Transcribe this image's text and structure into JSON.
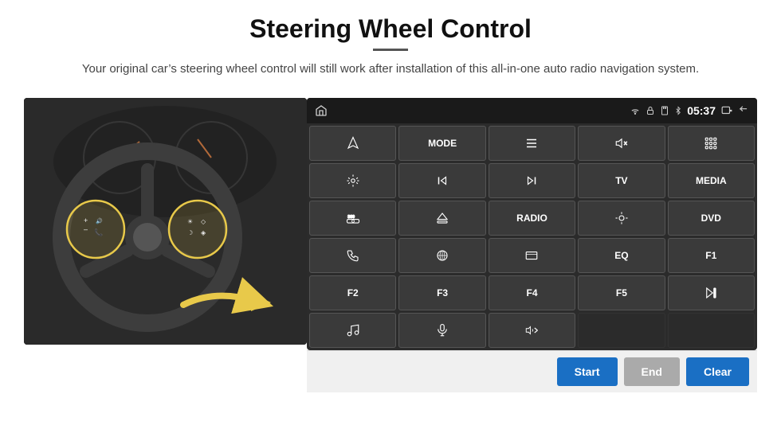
{
  "header": {
    "title": "Steering Wheel Control",
    "subtitle": "Your original car’s steering wheel control will still work after installation of this all-in-one auto radio navigation system."
  },
  "topbar": {
    "time": "05:37"
  },
  "panel_buttons": [
    {
      "id": "row1",
      "cells": [
        {
          "label": "",
          "icon": "home"
        },
        {
          "label": "MODE",
          "icon": ""
        },
        {
          "label": "",
          "icon": "list"
        },
        {
          "label": "",
          "icon": "vol-mute"
        },
        {
          "label": "",
          "icon": "apps"
        }
      ]
    },
    {
      "id": "row2",
      "cells": [
        {
          "label": "",
          "icon": "settings"
        },
        {
          "label": "",
          "icon": "prev"
        },
        {
          "label": "",
          "icon": "next"
        },
        {
          "label": "TV",
          "icon": ""
        },
        {
          "label": "MEDIA",
          "icon": ""
        }
      ]
    },
    {
      "id": "row3",
      "cells": [
        {
          "label": "",
          "icon": "360cam"
        },
        {
          "label": "",
          "icon": "eject"
        },
        {
          "label": "RADIO",
          "icon": ""
        },
        {
          "label": "",
          "icon": "brightness"
        },
        {
          "label": "DVD",
          "icon": ""
        }
      ]
    },
    {
      "id": "row4",
      "cells": [
        {
          "label": "",
          "icon": "phone"
        },
        {
          "label": "",
          "icon": "gps"
        },
        {
          "label": "",
          "icon": "window"
        },
        {
          "label": "EQ",
          "icon": ""
        },
        {
          "label": "F1",
          "icon": ""
        }
      ]
    },
    {
      "id": "row5",
      "cells": [
        {
          "label": "F2",
          "icon": ""
        },
        {
          "label": "F3",
          "icon": ""
        },
        {
          "label": "F4",
          "icon": ""
        },
        {
          "label": "F5",
          "icon": ""
        },
        {
          "label": "",
          "icon": "play-pause"
        }
      ]
    },
    {
      "id": "row6",
      "cells": [
        {
          "label": "",
          "icon": "music"
        },
        {
          "label": "",
          "icon": "mic"
        },
        {
          "label": "",
          "icon": "vol-phone"
        },
        {
          "label": "",
          "icon": ""
        },
        {
          "label": "",
          "icon": ""
        }
      ]
    }
  ],
  "bottom_buttons": {
    "start": "Start",
    "end": "End",
    "clear": "Clear"
  }
}
